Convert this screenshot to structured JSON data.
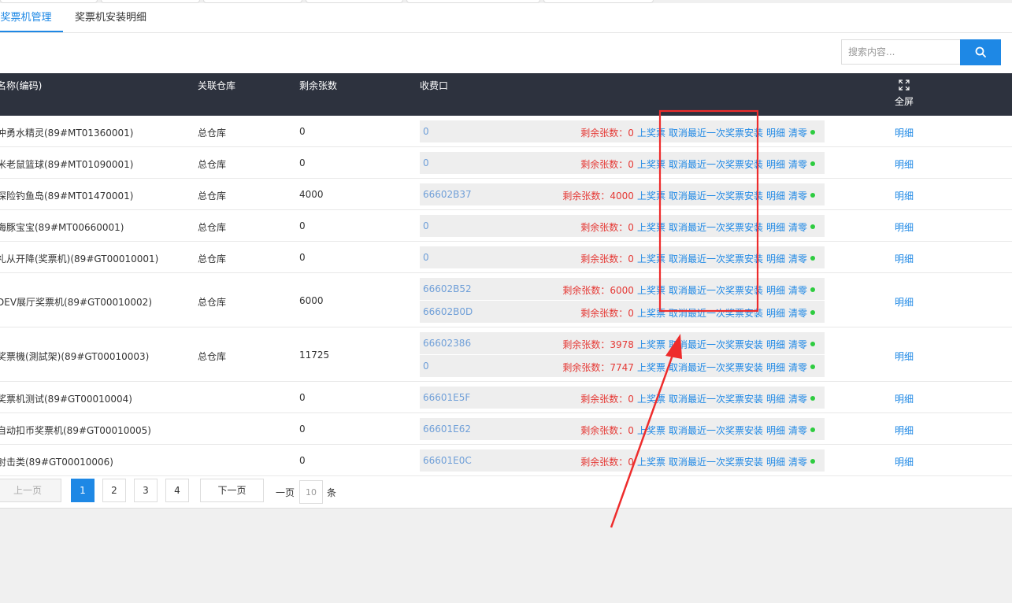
{
  "tabs": [
    {
      "label": "奖票机管理",
      "active": true
    },
    {
      "label": "奖票机安装明细",
      "active": false
    }
  ],
  "search": {
    "placeholder": "搜索内容..."
  },
  "table": {
    "headers": [
      "名称(编码)",
      "关联仓库",
      "剩余张数",
      "收费口"
    ],
    "fullscreen_label": "全屏",
    "remain_prefix": "剩余张数：",
    "actions": {
      "upload": "上奖票",
      "cancel": "取消最近一次奖票安装",
      "detail": "明细",
      "clear": "清零"
    },
    "row_detail": "明细",
    "rows": [
      {
        "name": "冲勇水精灵(89#MT01360001)",
        "warehouse": "总仓库",
        "remaining": "0",
        "ports": [
          {
            "id": "0",
            "remain": "0"
          }
        ]
      },
      {
        "name": "米老鼠篮球(89#MT01090001)",
        "warehouse": "总仓库",
        "remaining": "0",
        "ports": [
          {
            "id": "0",
            "remain": "0"
          }
        ]
      },
      {
        "name": "探险钓鱼岛(89#MT01470001)",
        "warehouse": "总仓库",
        "remaining": "4000",
        "ports": [
          {
            "id": "66602B37",
            "remain": "4000"
          }
        ]
      },
      {
        "name": "海豚宝宝(89#MT00660001)",
        "warehouse": "总仓库",
        "remaining": "0",
        "ports": [
          {
            "id": "0",
            "remain": "0"
          }
        ]
      },
      {
        "name": "礼从开降(奖票机)(89#GT00010001)",
        "warehouse": "总仓库",
        "remaining": "0",
        "ports": [
          {
            "id": "0",
            "remain": "0"
          }
        ]
      },
      {
        "name": "DEV展厅奖票机(89#GT00010002)",
        "warehouse": "总仓库",
        "remaining": "6000",
        "ports": [
          {
            "id": "66602B52",
            "remain": "6000"
          },
          {
            "id": "66602B0D",
            "remain": "0"
          }
        ]
      },
      {
        "name": "奖票機(測試架)(89#GT00010003)",
        "warehouse": "总仓库",
        "remaining": "11725",
        "ports": [
          {
            "id": "66602386",
            "remain": "3978"
          },
          {
            "id": "0",
            "remain": "7747"
          }
        ]
      },
      {
        "name": "奖票机测试(89#GT00010004)",
        "warehouse": "",
        "remaining": "0",
        "ports": [
          {
            "id": "66601E5F",
            "remain": "0"
          }
        ]
      },
      {
        "name": "自动扣币奖票机(89#GT00010005)",
        "warehouse": "",
        "remaining": "0",
        "ports": [
          {
            "id": "66601E62",
            "remain": "0"
          }
        ]
      },
      {
        "name": "射击类(89#GT00010006)",
        "warehouse": "",
        "remaining": "0",
        "ports": [
          {
            "id": "66601E0C",
            "remain": "0"
          }
        ]
      }
    ]
  },
  "pagination": {
    "prev": "上一页",
    "next": "下一页",
    "pages": [
      "1",
      "2",
      "3",
      "4"
    ],
    "current": "1",
    "per_page_prefix": "一页",
    "per_page_value": "10",
    "per_page_suffix": "条"
  },
  "colors": {
    "accent": "#1e88e5",
    "header_bg": "#2d323e",
    "remain_red": "#e53935",
    "status_green": "#2ecc40",
    "annotation_red": "#ee2c2c"
  }
}
